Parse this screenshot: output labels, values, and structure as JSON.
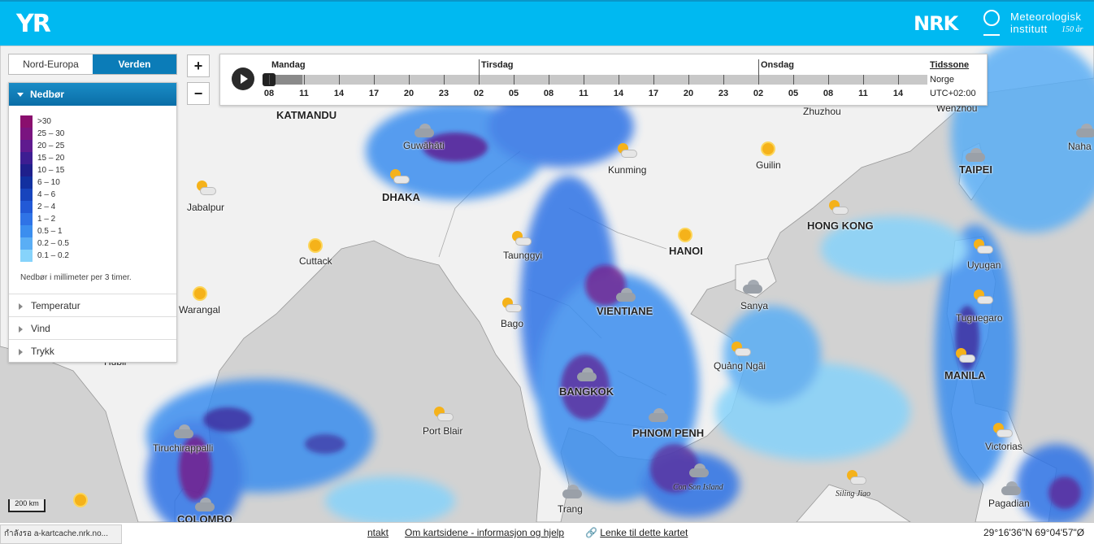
{
  "header": {
    "logo": "YR",
    "nrk_logo": "NRK",
    "met_line1": "Meteorologisk",
    "met_line2": "institutt",
    "met_years": "150 år"
  },
  "region_tabs": [
    "Nord-Europa",
    "Verden"
  ],
  "active_region": "Verden",
  "legend": {
    "title": "Nedbør",
    "items": [
      {
        "label": ">30",
        "color": "#8a0f6e"
      },
      {
        "label": "25 – 30",
        "color": "#7a1480"
      },
      {
        "label": "20 – 25",
        "color": "#5f1a8f"
      },
      {
        "label": "15 – 20",
        "color": "#3d1d92"
      },
      {
        "label": "10 – 15",
        "color": "#1f1f8c"
      },
      {
        "label": "6 – 10",
        "color": "#1230a0"
      },
      {
        "label": "4 – 6",
        "color": "#1744bd"
      },
      {
        "label": "2 – 4",
        "color": "#2259d6"
      },
      {
        "label": "1 – 2",
        "color": "#2f73e6"
      },
      {
        "label": "0.5 – 1",
        "color": "#3b8eef"
      },
      {
        "label": "0.2 – 0.5",
        "color": "#5aaef5"
      },
      {
        "label": "0.1 – 0.2",
        "color": "#86d3fb"
      }
    ],
    "note": "Nedbør i millimeter per 3 timer."
  },
  "layers": [
    "Temperatur",
    "Vind",
    "Trykk"
  ],
  "zoom": {
    "in": "+",
    "out": "−"
  },
  "timeline": {
    "days": [
      "Mandag",
      "Tirsdag",
      "Onsdag"
    ],
    "hours": [
      "08",
      "11",
      "14",
      "17",
      "20",
      "23",
      "02",
      "05",
      "08",
      "11",
      "14",
      "17",
      "20",
      "23",
      "02",
      "05",
      "08",
      "11",
      "14"
    ],
    "tz_title": "Tidssone",
    "tz_name": "Norge",
    "tz_offset": "UTC+02:00",
    "progress": 0.06
  },
  "cities": [
    {
      "name": "KATMANDU",
      "cap": true
    },
    {
      "name": "Guwāhāti",
      "cap": false
    },
    {
      "name": "DHAKA",
      "cap": true
    },
    {
      "name": "Jabalpur",
      "cap": false
    },
    {
      "name": "Cuttack",
      "cap": false
    },
    {
      "name": "Warangal",
      "cap": false
    },
    {
      "name": "Kunming",
      "cap": false
    },
    {
      "name": "Guilin",
      "cap": false
    },
    {
      "name": "Zhuzhou",
      "cap": false
    },
    {
      "name": "TAIPEI",
      "cap": true
    },
    {
      "name": "Naha",
      "cap": false
    },
    {
      "name": "HONG KONG",
      "cap": true
    },
    {
      "name": "Taunggyi",
      "cap": false
    },
    {
      "name": "HANOI",
      "cap": true
    },
    {
      "name": "Sanya",
      "cap": false
    },
    {
      "name": "Uyugan",
      "cap": false
    },
    {
      "name": "VIENTIANE",
      "cap": true
    },
    {
      "name": "Bago",
      "cap": false
    },
    {
      "name": "Tuguegaro",
      "cap": false
    },
    {
      "name": "Quảng Ngãi",
      "cap": false
    },
    {
      "name": "MANILA",
      "cap": true
    },
    {
      "name": "BANGKOK",
      "cap": true
    },
    {
      "name": "Port Blair",
      "cap": false
    },
    {
      "name": "PHNOM PENH",
      "cap": true
    },
    {
      "name": "Victorias",
      "cap": false
    },
    {
      "name": "Tiruchirappalli",
      "cap": false
    },
    {
      "name": "COLOMBO",
      "cap": true
    },
    {
      "name": "Trang",
      "cap": false
    },
    {
      "name": "Pagadian",
      "cap": false
    },
    {
      "name": "Wenzhou",
      "cap": false
    },
    {
      "name": "Hubli",
      "cap": false
    }
  ],
  "islands": [
    "Con Son Island",
    "Siling Jiao"
  ],
  "scale": "200 km",
  "footer": {
    "status": "กำลังรอ a-kartcache.nrk.no...",
    "contact": "ntakt",
    "about": "Om kartsidene - informasjon og hjelp",
    "link": "Lenke til dette kartet",
    "coords": "29°16'36\"N 69°04'57\"Ø"
  }
}
